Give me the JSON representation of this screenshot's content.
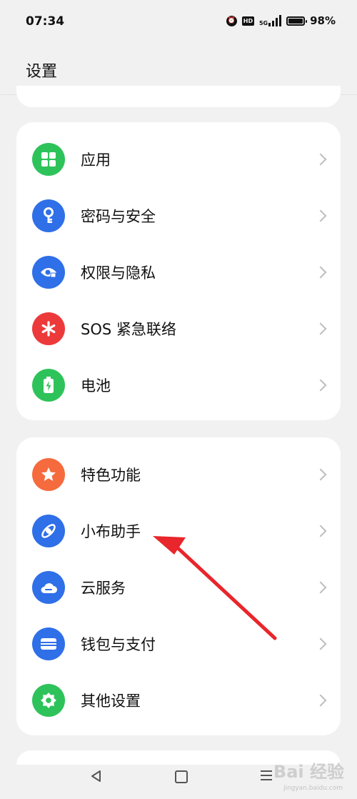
{
  "status": {
    "time": "07:34",
    "hd": "HD",
    "network": "5G",
    "battery": "98%",
    "battery_level": 0.98
  },
  "header": {
    "title": "设置"
  },
  "groups": [
    {
      "items": [
        {
          "label": "应用",
          "icon": "apps-grid-icon",
          "color": "#2ec35a"
        },
        {
          "label": "密码与安全",
          "icon": "key-icon",
          "color": "#2f6fe8"
        },
        {
          "label": "权限与隐私",
          "icon": "privacy-eye-icon",
          "color": "#2f6fe8"
        },
        {
          "label": "SOS 紧急联络",
          "icon": "asterisk-icon",
          "color": "#ec3a3a"
        },
        {
          "label": "电池",
          "icon": "battery-charge-icon",
          "color": "#2ec35a"
        }
      ]
    },
    {
      "items": [
        {
          "label": "特色功能",
          "icon": "star-icon",
          "color": "#f56b3d"
        },
        {
          "label": "小布助手",
          "icon": "assistant-icon",
          "color": "#2f6fe8"
        },
        {
          "label": "云服务",
          "icon": "cloud-icon",
          "color": "#2f6fe8"
        },
        {
          "label": "钱包与支付",
          "icon": "wallet-icon",
          "color": "#2f6fe8"
        },
        {
          "label": "其他设置",
          "icon": "gear-icon",
          "color": "#2ec35a"
        }
      ]
    }
  ],
  "annotation": {
    "color": "#e8262b",
    "target": "小布助手"
  },
  "watermark": {
    "text": "Bai 经验",
    "sub": "jingyan.baidu.com"
  }
}
